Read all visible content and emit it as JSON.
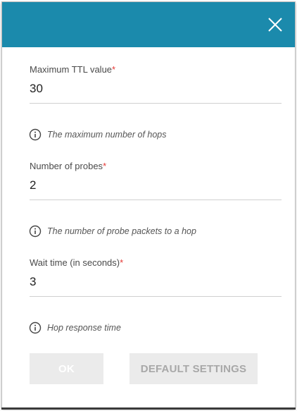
{
  "dialog": {
    "header_color": "#1b8aac",
    "close_icon": "close-icon"
  },
  "fields": {
    "max_ttl": {
      "label": "Maximum TTL value",
      "required_mark": "*",
      "value": "30",
      "hint": "The maximum number of hops"
    },
    "probes": {
      "label": "Number of probes",
      "required_mark": "*",
      "value": "2",
      "hint": "The number of probe packets to a hop"
    },
    "wait_time": {
      "label": "Wait time (in seconds)",
      "required_mark": "*",
      "value": "3",
      "hint": "Hop response time"
    }
  },
  "buttons": {
    "ok_label": "OK",
    "default_label": "DEFAULT SETTINGS"
  },
  "colors": {
    "required": "#e53935",
    "button_bg": "#ebebeb"
  }
}
